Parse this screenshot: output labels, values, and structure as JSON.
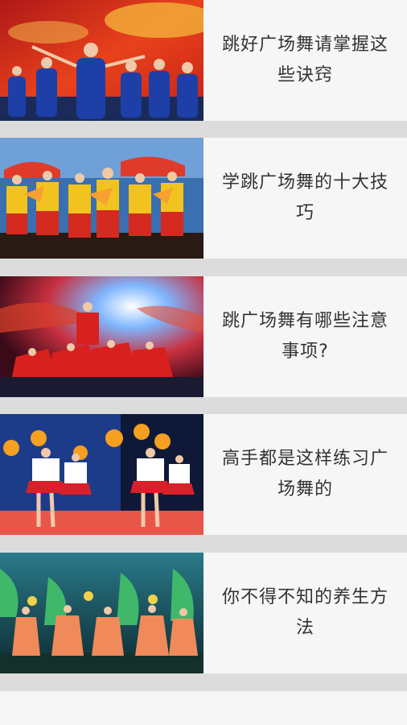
{
  "articles": [
    {
      "title": "跳好广场舞请掌握这些诀窍",
      "image": "dancers-blue-costumes"
    },
    {
      "title": "学跳广场舞的十大技巧",
      "image": "dancers-yellow-fans"
    },
    {
      "title": "跳广场舞有哪些注意事项?",
      "image": "dancers-red-stage"
    },
    {
      "title": "高手都是这样练习广场舞的",
      "image": "cheerleaders-pompoms"
    },
    {
      "title": "你不得不知的养生方法",
      "image": "dancers-green-costumes"
    }
  ],
  "colors": {
    "background": "#dcdcdc",
    "card": "#f6f6f6",
    "text": "#333333"
  }
}
